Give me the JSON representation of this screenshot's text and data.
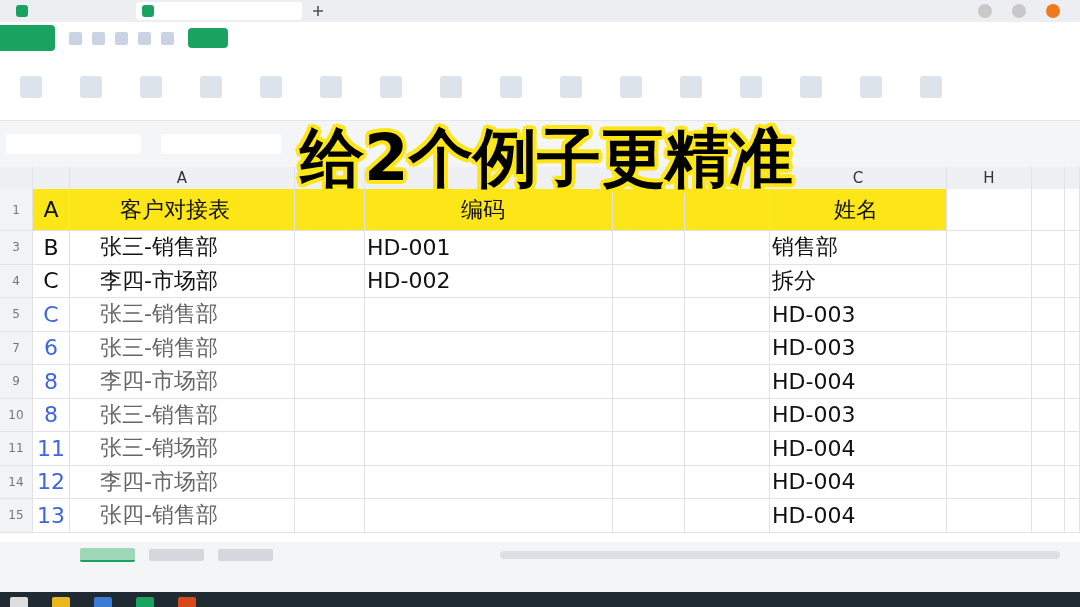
{
  "caption": "给2个例子更精准",
  "sheet": {
    "column_headers": [
      "A",
      "C",
      "H"
    ],
    "rows": [
      {
        "number": "1",
        "header": true,
        "faded": false,
        "cells": [
          "A",
          "客户对接表",
          "编码",
          "姓名"
        ]
      },
      {
        "number": "3",
        "header": false,
        "faded": false,
        "cells": [
          "B",
          "张三-销售部",
          "HD-001",
          "销售部"
        ]
      },
      {
        "number": "4",
        "header": false,
        "faded": false,
        "cells": [
          "C",
          "李四-市场部",
          "HD-002",
          "拆分"
        ]
      },
      {
        "number": "5",
        "header": false,
        "faded": true,
        "cells": [
          "C",
          "张三-销售部",
          "",
          "HD-003"
        ]
      },
      {
        "number": "7",
        "header": false,
        "faded": true,
        "cells": [
          "6",
          "张三-销售部",
          "",
          "HD-003"
        ]
      },
      {
        "number": "9",
        "header": false,
        "faded": true,
        "cells": [
          "8",
          "李四-市场部",
          "",
          "HD-004"
        ]
      },
      {
        "number": "10",
        "header": false,
        "faded": true,
        "cells": [
          "8",
          "张三-销售部",
          "",
          "HD-003"
        ]
      },
      {
        "number": "11",
        "header": false,
        "faded": true,
        "cells": [
          "11",
          "张三-销场部",
          "",
          "HD-004"
        ]
      },
      {
        "number": "14",
        "header": false,
        "faded": true,
        "cells": [
          "12",
          "李四-市场部",
          "",
          "HD-004"
        ]
      },
      {
        "number": "15",
        "header": false,
        "faded": true,
        "cells": [
          "13",
          "张四-销售部",
          "",
          "HD-004"
        ]
      }
    ]
  },
  "sheet_tabs": [
    {
      "selected": true
    },
    {
      "selected": false
    },
    {
      "selected": false
    }
  ]
}
